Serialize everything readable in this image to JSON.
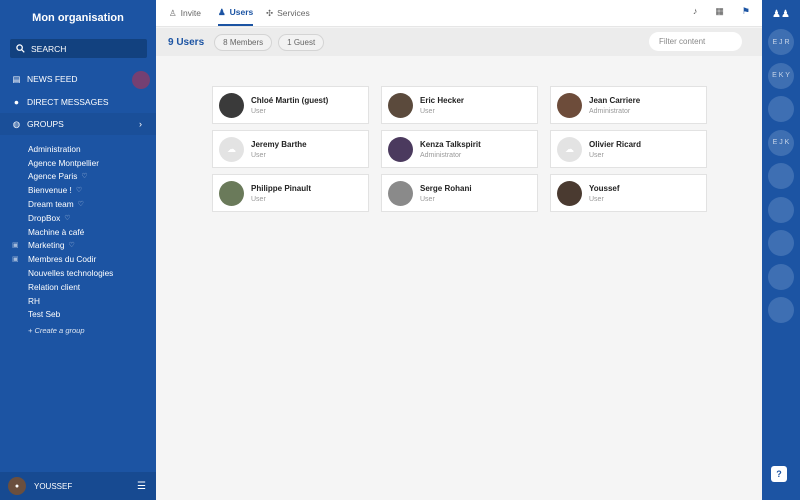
{
  "sidebar": {
    "org_title": "Mon organisation",
    "search_label": "SEARCH",
    "news_feed": "NEWS FEED",
    "direct_messages": "DIRECT MESSAGES",
    "groups_label": "GROUPS",
    "groups": [
      {
        "name": "Administration",
        "locked": false,
        "fav": false
      },
      {
        "name": "Agence Montpellier",
        "locked": false,
        "fav": false
      },
      {
        "name": "Agence Paris",
        "locked": false,
        "fav": true
      },
      {
        "name": "Bienvenue !",
        "locked": false,
        "fav": true
      },
      {
        "name": "Dream team",
        "locked": false,
        "fav": true
      },
      {
        "name": "DropBox",
        "locked": false,
        "fav": true
      },
      {
        "name": "Machine à café",
        "locked": false,
        "fav": false
      },
      {
        "name": "Marketing",
        "locked": true,
        "fav": true
      },
      {
        "name": "Membres du Codir",
        "locked": true,
        "fav": false
      },
      {
        "name": "Nouvelles technologies",
        "locked": false,
        "fav": false
      },
      {
        "name": "Relation client",
        "locked": false,
        "fav": false
      },
      {
        "name": "RH",
        "locked": false,
        "fav": false
      },
      {
        "name": "Test Seb",
        "locked": false,
        "fav": false
      }
    ],
    "create_group": "+ Create a group",
    "current_user": "YOUSSEF"
  },
  "topbar": {
    "tabs": [
      {
        "label": "Invite",
        "icon": "user-plus-icon"
      },
      {
        "label": "Users",
        "icon": "users-icon"
      },
      {
        "label": "Services",
        "icon": "services-icon"
      }
    ],
    "active_tab": "Users"
  },
  "subbar": {
    "count": "9 Users",
    "members_pill": "8 Members",
    "guest_pill": "1 Guest",
    "filter_placeholder": "Filter content"
  },
  "users": [
    {
      "name": "Chloé Martin (guest)",
      "role": "User",
      "color": "#3a3a3a"
    },
    {
      "name": "Eric Hecker",
      "role": "User",
      "color": "#5b4a3c"
    },
    {
      "name": "Jean Carriere",
      "role": "Administrator",
      "color": "#6d4c3a"
    },
    {
      "name": "Jeremy Barthe",
      "role": "User",
      "color": "#e3e3e3"
    },
    {
      "name": "Kenza Talkspirit",
      "role": "Administrator",
      "color": "#4b3a5e"
    },
    {
      "name": "Olivier Ricard",
      "role": "User",
      "color": "#e3e3e3"
    },
    {
      "name": "Philippe Pinault",
      "role": "User",
      "color": "#6a7a5a"
    },
    {
      "name": "Serge Rohani",
      "role": "User",
      "color": "#8a8a8a"
    },
    {
      "name": "Youssef",
      "role": "User",
      "color": "#4a3a30"
    }
  ],
  "rail": {
    "avatars": [
      "E J R",
      "E K Y",
      "",
      "E J K",
      "",
      "",
      "",
      "",
      ""
    ]
  },
  "colors": {
    "brand": "#1c54a3",
    "accent_dot": "#c0304a"
  }
}
